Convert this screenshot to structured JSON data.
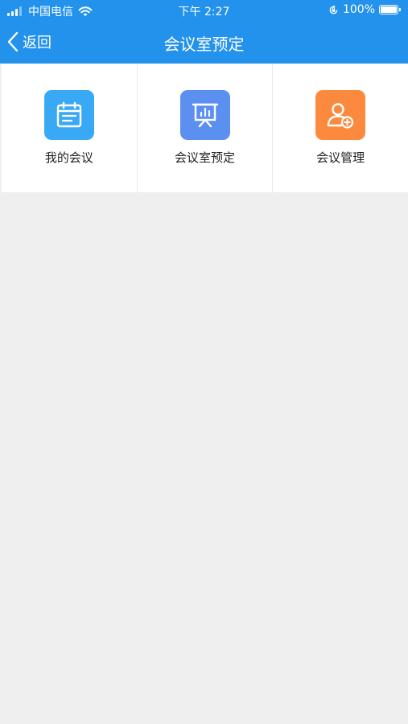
{
  "statusbar": {
    "carrier": "中国电信",
    "time": "下午 2:27",
    "battery": "100%"
  },
  "nav": {
    "back_label": "返回",
    "title": "会议室预定"
  },
  "menu": [
    {
      "label": "我的会议",
      "icon": "calendar-icon",
      "color": "#3aa9f5"
    },
    {
      "label": "会议室预定",
      "icon": "presentation-board-icon",
      "color": "#5b8ff0"
    },
    {
      "label": "会议管理",
      "icon": "user-add-icon",
      "color": "#fb8a3e"
    }
  ],
  "colors": {
    "header": "#2392ec",
    "background": "#efefef"
  }
}
